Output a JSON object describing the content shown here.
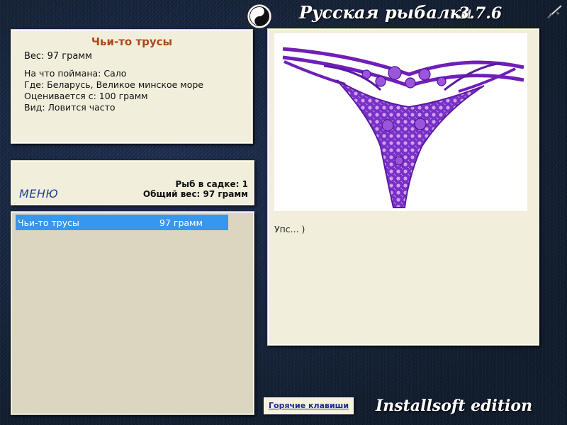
{
  "header": {
    "logo_icon": "yin-yang-icon",
    "title": "Русская рыбалка",
    "version": "3.7.6",
    "corner_icon": "fishing-rod-icon"
  },
  "fish_info": {
    "name": "Чьи-то трусы",
    "weight": "Вес: 97 грамм",
    "bait": "На что поймана: Сало",
    "location": "Где: Беларусь, Великое минское море",
    "rated_from": "Оценивается с: 100 грамм",
    "frequency": "Вид: Ловится часто"
  },
  "menu": {
    "label": "МЕНЮ"
  },
  "stats": {
    "fish_count": "Рыб в садке: 1",
    "total_weight": "Общий вес: 97 грамм"
  },
  "catch_list": [
    {
      "name": "Чьи-то трусы",
      "weight": "97 грамм",
      "selected": true
    }
  ],
  "picture": {
    "image": "purple-lace-underwear",
    "description": "Упс... )"
  },
  "footer": {
    "hotkeys_label": "Горячие клавиши",
    "edition": "Installsoft edition"
  },
  "colors": {
    "fish_name": "#b04616",
    "selection": "#3797ee",
    "menu_link": "#1c3f96",
    "panel": "#f2eedc"
  }
}
